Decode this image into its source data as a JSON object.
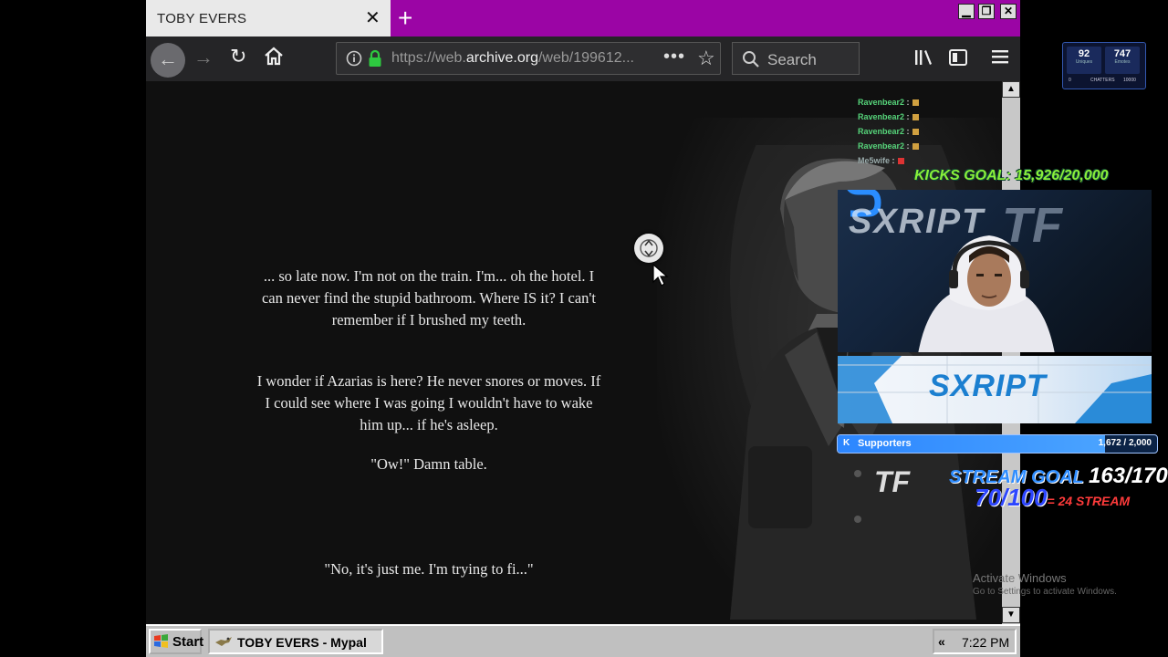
{
  "browser": {
    "tab_title": "TOBY EVERS",
    "tab_close": "✕",
    "new_tab": "+",
    "window_buttons": [
      "▁",
      "❐",
      "✕"
    ],
    "url_prefix": "https://web.",
    "url_domain": "archive.org",
    "url_suffix": "/web/199612...",
    "url_more": "•••",
    "search_placeholder": "Search"
  },
  "page": {
    "paragraphs": [
      "... so late now. I'm not on the train. I'm... oh the hotel. I can never find the stupid bathroom. Where IS it? I can't remember if I brushed my teeth.",
      "I wonder if Azarias is here? He never snores or moves. If I could see where I was going I wouldn't have to wake him up... if he's asleep.",
      "\"Ow!\" Damn table.",
      "\"No, it's just me. I'm trying to fi...\""
    ]
  },
  "taskbar": {
    "start_label": "Start",
    "task_label": "TOBY EVERS - Mypal",
    "tray_arrows": "«",
    "clock": "7:22 PM"
  },
  "overlay": {
    "stats": {
      "uniques_value": "92",
      "uniques_label": "Uniques",
      "emotes_value": "747",
      "emotes_label": "Emotes",
      "bar_min": "0",
      "bar_label": "CHATTERS",
      "bar_max": "10000"
    },
    "chat": [
      {
        "user": "Ravenbear2",
        "sep": " :"
      },
      {
        "user": "Ravenbear2",
        "sep": " :"
      },
      {
        "user": "Ravenbear2",
        "sep": " :"
      },
      {
        "user": "Ravenbear2",
        "sep": " :"
      },
      {
        "user": "Me5wife",
        "sep": " :"
      }
    ],
    "kicks_goal": "KICKS GOAL: 15,926/20,000",
    "webcam_wall_text": "SXRIPT",
    "webcam_wall_logo": "TF",
    "banner_text": "SXRIPT",
    "supporters": {
      "icon": "K",
      "label": "Supporters",
      "count": "1,672 / 2,000",
      "current": 1672,
      "target": 2000
    },
    "tf_logo": "TF",
    "stream_goal_label": "STREAM GOAL",
    "stream_goal_value": "163/170",
    "stream_sub_value": "70/100",
    "stream_sub_note": "= 24 STREAM",
    "activate_title": "Activate Windows",
    "activate_sub": "Go to Settings to activate Windows."
  },
  "colors": {
    "tabbar": "#9b05a5",
    "kicks_goal": "#8af03a",
    "supporters_fill": "#2c86ff",
    "stream_goal": "#2f8dff"
  }
}
